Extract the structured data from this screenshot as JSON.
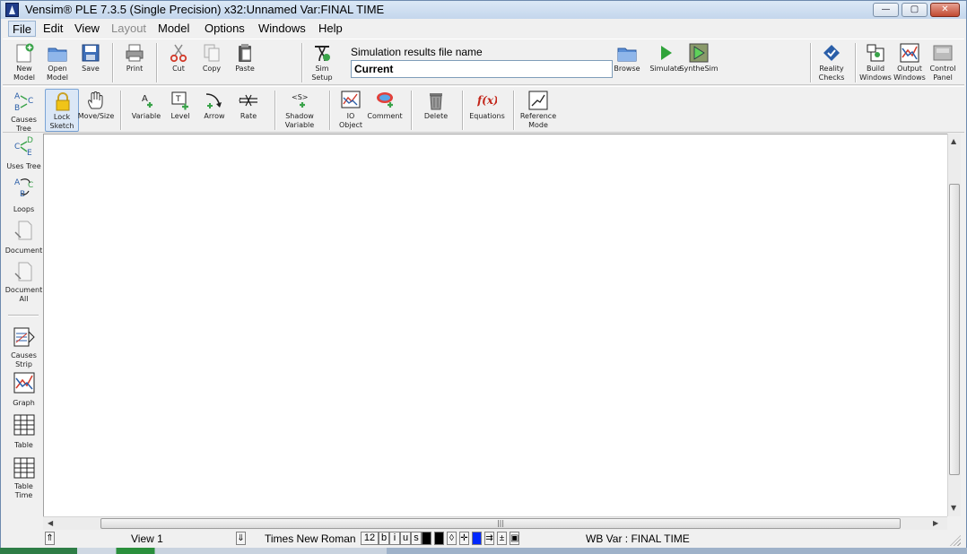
{
  "window": {
    "title": "Vensim® PLE 7.3.5 (Single Precision) x32:Unnamed Var:FINAL TIME",
    "controls": {
      "minimize": "—",
      "maximize": "▢",
      "close": "✕"
    }
  },
  "menu": [
    "File",
    "Edit",
    "View",
    "Layout",
    "Model",
    "Options",
    "Windows",
    "Help"
  ],
  "toolbar_main": {
    "new_model": "New\nModel",
    "open_model": "Open\nModel",
    "save": "Save",
    "print": "Print",
    "cut": "Cut",
    "copy": "Copy",
    "paste": "Paste",
    "sim_setup": "Sim\nSetup",
    "sim_results_label": "Simulation results file name",
    "sim_results_value": "Current",
    "browse": "Browse",
    "simulate": "Simulate",
    "synthesim": "SyntheSim",
    "reality_checks": "Reality\nChecks",
    "build_windows": "Build\nWindows",
    "output_windows": "Output\nWindows",
    "control_panel": "Control\nPanel"
  },
  "toolbar_sketch": {
    "lock_sketch": "Lock\nSketch",
    "move_size": "Move/Size",
    "variable": "Variable",
    "level": "Level",
    "arrow": "Arrow",
    "rate": "Rate",
    "shadow_variable": "Shadow\nVariable",
    "io_object": "IO\nObject",
    "comment": "Comment",
    "delete": "Delete",
    "equations": "Equations",
    "reference_mode": "Reference\nMode"
  },
  "palette": {
    "causes_tree": "Causes\nTree",
    "uses_tree": "Uses Tree",
    "loops": "Loops",
    "document": "Document",
    "document_all": "Document\nAll",
    "causes_strip": "Causes\nStrip",
    "graph": "Graph",
    "table": "Table",
    "table_time": "Table\nTime"
  },
  "statusbar": {
    "view": "View 1",
    "font": "Times New Roman",
    "font_size": "12",
    "bold": "b",
    "italic": "i",
    "underline": "u",
    "strike": "s",
    "workbench": "WB Var : FINAL TIME"
  },
  "colors": {
    "accent": "#2a5ea8",
    "simulate_green": "#2fa33a",
    "canvas": "#ffffff",
    "chrome": "#f0f0f0"
  }
}
